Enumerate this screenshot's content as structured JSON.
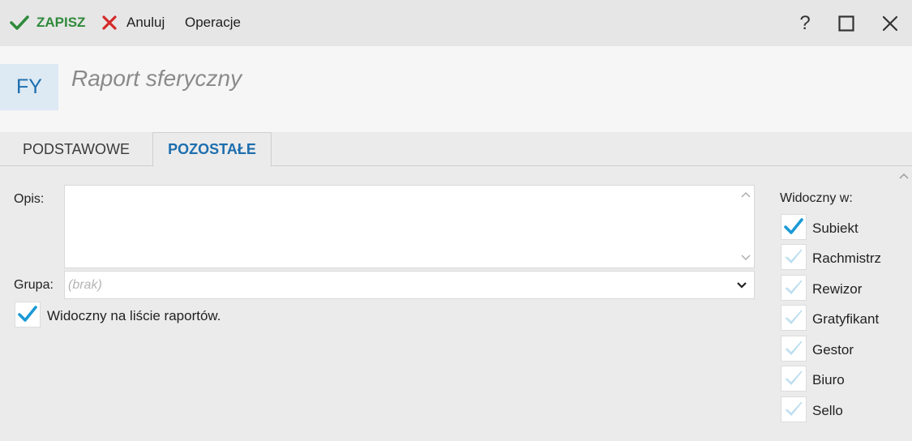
{
  "toolbar": {
    "save_label": "ZAPISZ",
    "cancel_label": "Anuluj",
    "operations_label": "Operacje",
    "help_label": "?"
  },
  "header": {
    "badge": "FY",
    "title": "Raport sferyczny"
  },
  "tabs": [
    {
      "label": "PODSTAWOWE",
      "active": false
    },
    {
      "label": "POZOSTAŁE",
      "active": true
    }
  ],
  "form": {
    "opis_label": "Opis:",
    "opis_value": "",
    "grupa_label": "Grupa:",
    "grupa_value": "(brak)",
    "visible_on_list_label": "Widoczny na liście raportów.",
    "visible_on_list_checked": true
  },
  "visible_in": {
    "heading": "Widoczny w:",
    "items": [
      {
        "label": "Subiekt",
        "checked": true
      },
      {
        "label": "Rachmistrz",
        "checked": false
      },
      {
        "label": "Rewizor",
        "checked": false
      },
      {
        "label": "Gratyfikant",
        "checked": false
      },
      {
        "label": "Gestor",
        "checked": false
      },
      {
        "label": "Biuro",
        "checked": false
      },
      {
        "label": "Sello",
        "checked": false
      }
    ]
  },
  "colors": {
    "accent": "#1c6eae",
    "save_green": "#2f8a3a",
    "cancel_red": "#d42a2a",
    "check_blue": "#1a9ad6"
  }
}
